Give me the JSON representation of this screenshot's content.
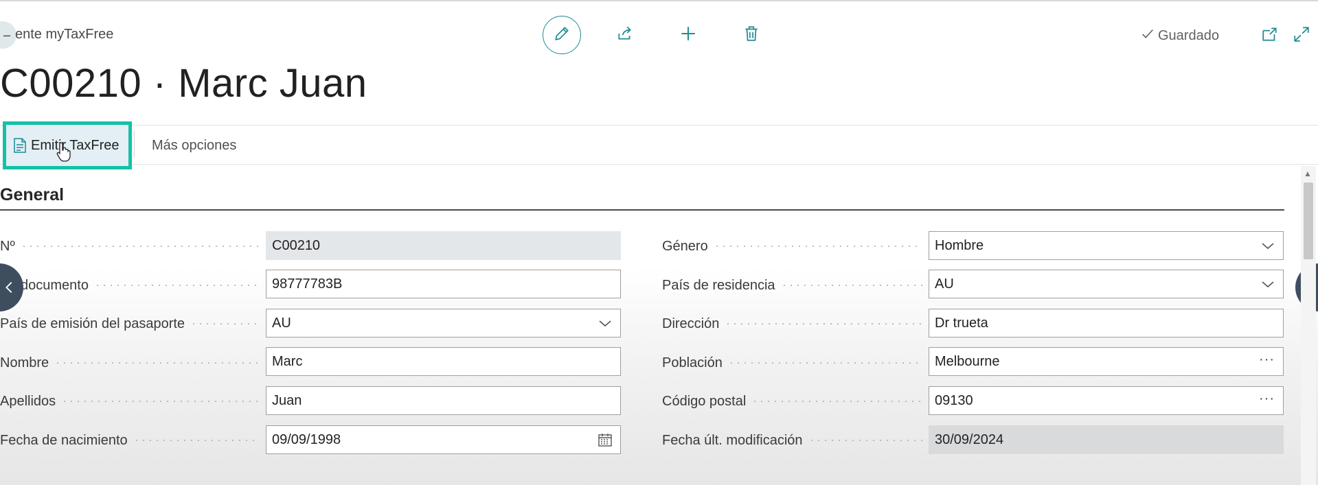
{
  "header": {
    "breadcrumb": "ente myTaxFree",
    "status": "Guardado",
    "title": "C00210 · Marc Juan"
  },
  "icons": {
    "edit": "pencil-icon",
    "share": "share-icon",
    "new": "plus-icon",
    "delete": "trash-icon",
    "saved": "check-icon",
    "open_new_window": "open-new-window-icon",
    "expand": "expand-icon"
  },
  "commands": {
    "primary_label": "Emitir TaxFree",
    "more_label": "Más opciones"
  },
  "section": {
    "title": "General"
  },
  "left_fields": [
    {
      "label": "Nº",
      "value": "C00210",
      "kind": "readonly"
    },
    {
      "label": "documento",
      "value": "98777783B",
      "kind": "text"
    },
    {
      "label": "País de emisión del pasaporte",
      "value": "AU",
      "kind": "dropdown"
    },
    {
      "label": "Nombre",
      "value": "Marc",
      "kind": "text"
    },
    {
      "label": "Apellidos",
      "value": "Juan",
      "kind": "text"
    },
    {
      "label": "Fecha de nacimiento",
      "value": "09/09/1998",
      "kind": "date"
    }
  ],
  "right_fields": [
    {
      "label": "Género",
      "value": "Hombre",
      "kind": "dropdown"
    },
    {
      "label": "País de residencia",
      "value": "AU",
      "kind": "dropdown"
    },
    {
      "label": "Dirección",
      "value": "Dr trueta",
      "kind": "text"
    },
    {
      "label": "Población",
      "value": "Melbourne",
      "kind": "lookup"
    },
    {
      "label": "Código postal",
      "value": "09130",
      "kind": "lookup"
    },
    {
      "label": "Fecha últ. modificación",
      "value": "30/09/2024",
      "kind": "readonly"
    }
  ],
  "lookup_glyph": "···",
  "colors": {
    "accent": "#1d8a93",
    "highlight": "#14c1a6",
    "nav_button": "#3f4e5f"
  }
}
